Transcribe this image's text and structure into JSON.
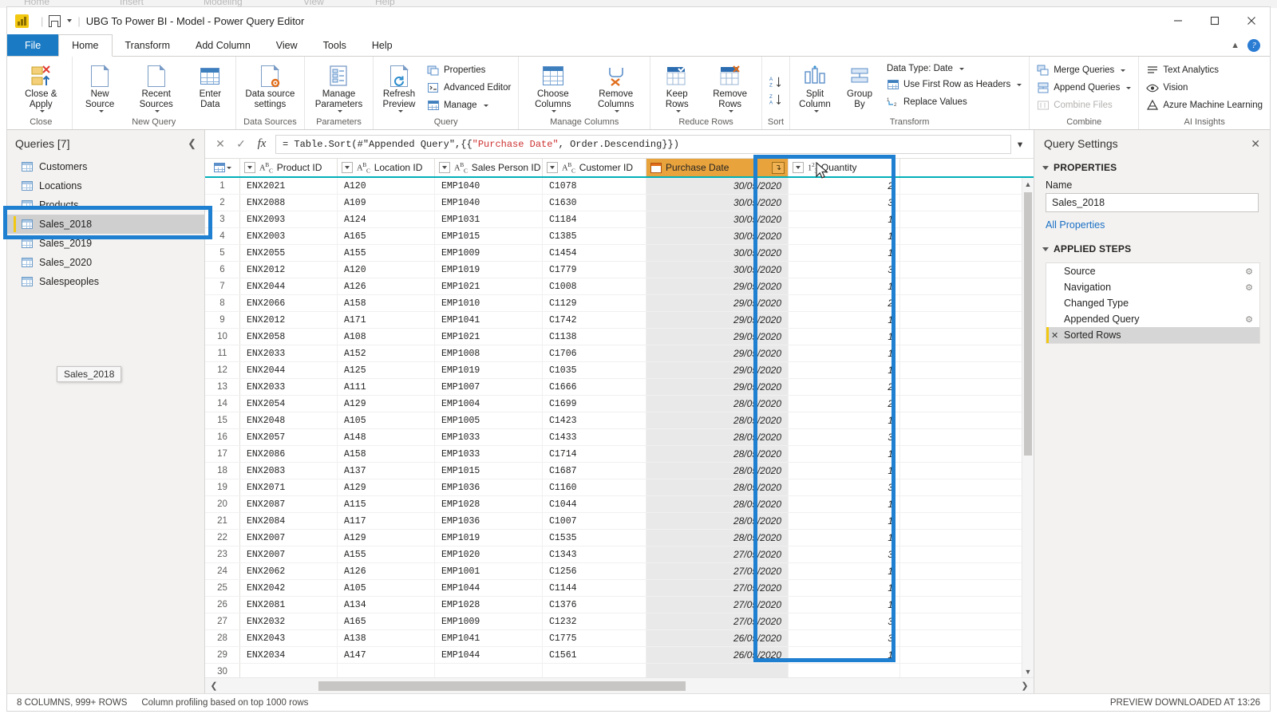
{
  "ghost_menu": [
    "Home",
    "Insert",
    "Modeling",
    "View",
    "Help"
  ],
  "titlebar": {
    "app_icon": "power-bi-logo",
    "save_icon": "save-icon",
    "dropdown_icon": "chevron-down-icon",
    "title": "UBG To Power BI - Model - Power Query Editor",
    "minimize": "minimize-icon",
    "maximize": "maximize-icon",
    "close": "close-icon",
    "collapse_ribbon": "chevron-up-icon",
    "help": "?"
  },
  "tabs": [
    {
      "label": "File",
      "state": "file"
    },
    {
      "label": "Home",
      "state": "active"
    },
    {
      "label": "Transform",
      "state": "normal"
    },
    {
      "label": "Add Column",
      "state": "normal"
    },
    {
      "label": "View",
      "state": "normal"
    },
    {
      "label": "Tools",
      "state": "normal"
    },
    {
      "label": "Help",
      "state": "normal"
    }
  ],
  "ribbon": {
    "groups": [
      {
        "name": "Close",
        "buttons": [
          {
            "label": "Close &\nApply",
            "icon": "close-apply-icon",
            "caret": true
          }
        ]
      },
      {
        "name": "New Query",
        "buttons": [
          {
            "label": "New\nSource",
            "icon": "new-source-icon",
            "caret": true
          },
          {
            "label": "Recent\nSources",
            "icon": "recent-sources-icon",
            "caret": true
          },
          {
            "label": "Enter\nData",
            "icon": "enter-data-icon",
            "caret": false
          }
        ]
      },
      {
        "name": "Data Sources",
        "buttons": [
          {
            "label": "Data source\nsettings",
            "icon": "data-source-settings-icon",
            "caret": false
          }
        ]
      },
      {
        "name": "Parameters",
        "buttons": [
          {
            "label": "Manage\nParameters",
            "icon": "manage-parameters-icon",
            "caret": true
          }
        ]
      },
      {
        "name": "Query",
        "buttons": [
          {
            "label": "Refresh\nPreview",
            "icon": "refresh-preview-icon",
            "caret": true
          }
        ],
        "small_buttons": [
          {
            "label": "Properties",
            "icon": "properties-icon",
            "disabled": false,
            "caret": false
          },
          {
            "label": "Advanced Editor",
            "icon": "advanced-editor-icon",
            "disabled": false,
            "caret": false
          },
          {
            "label": "Manage",
            "icon": "manage-icon",
            "disabled": false,
            "caret": true
          }
        ]
      },
      {
        "name": "Manage Columns",
        "buttons": [
          {
            "label": "Choose\nColumns",
            "icon": "choose-columns-icon",
            "caret": true
          },
          {
            "label": "Remove\nColumns",
            "icon": "remove-columns-icon",
            "caret": true
          }
        ]
      },
      {
        "name": "Reduce Rows",
        "buttons": [
          {
            "label": "Keep\nRows",
            "icon": "keep-rows-icon",
            "caret": true
          },
          {
            "label": "Remove\nRows",
            "icon": "remove-rows-icon",
            "caret": true
          }
        ]
      },
      {
        "name": "Sort",
        "small_buttons": [
          {
            "label": "",
            "icon": "sort-ascending-icon",
            "disabled": false,
            "caret": false
          },
          {
            "label": "",
            "icon": "sort-descending-icon",
            "disabled": false,
            "caret": false
          }
        ]
      },
      {
        "name": "Transform",
        "buttons": [
          {
            "label": "Split\nColumn",
            "icon": "split-column-icon",
            "caret": true
          },
          {
            "label": "Group\nBy",
            "icon": "group-by-icon",
            "caret": false
          }
        ],
        "small_buttons": [
          {
            "label": "Data Type: Date",
            "icon": "data-type-icon",
            "disabled": false,
            "caret": true
          },
          {
            "label": "Use First Row as Headers",
            "icon": "first-row-headers-icon",
            "disabled": false,
            "caret": true
          },
          {
            "label": "Replace Values",
            "icon": "replace-values-icon",
            "disabled": false,
            "caret": false
          }
        ]
      },
      {
        "name": "Combine",
        "small_buttons": [
          {
            "label": "Merge Queries",
            "icon": "merge-queries-icon",
            "disabled": false,
            "caret": true
          },
          {
            "label": "Append Queries",
            "icon": "append-queries-icon",
            "disabled": false,
            "caret": true
          },
          {
            "label": "Combine Files",
            "icon": "combine-files-icon",
            "disabled": true,
            "caret": false
          }
        ]
      },
      {
        "name": "AI Insights",
        "small_buttons": [
          {
            "label": "Text Analytics",
            "icon": "text-analytics-icon",
            "disabled": false,
            "caret": false
          },
          {
            "label": "Vision",
            "icon": "vision-eye-icon",
            "disabled": false,
            "caret": false
          },
          {
            "label": "Azure Machine Learning",
            "icon": "azure-ml-icon",
            "disabled": false,
            "caret": false
          }
        ]
      }
    ]
  },
  "queries_pane": {
    "header": "Queries [7]",
    "collapse_icon": "chevron-left-icon",
    "items": [
      {
        "label": "Customers",
        "selected": false
      },
      {
        "label": "Locations",
        "selected": false
      },
      {
        "label": "Products",
        "selected": false
      },
      {
        "label": "Sales_2018",
        "selected": true
      },
      {
        "label": "Sales_2019",
        "selected": false
      },
      {
        "label": "Sales_2020",
        "selected": false
      },
      {
        "label": "Salespeoples",
        "selected": false
      }
    ],
    "tooltip": "Sales_2018"
  },
  "formula_bar": {
    "cancel_icon": "cancel-x-icon",
    "commit_icon": "commit-check-icon",
    "fx_icon": "fx-icon",
    "formula_prefix": "= Table.Sort(#\"Appended Query\",{{",
    "formula_string": "\"Purchase Date\"",
    "formula_suffix": ", Order.Descending}})",
    "expand_icon": "chevron-down-icon"
  },
  "grid": {
    "corner_icon": "select-all-table-icon",
    "columns": [
      {
        "name": "Product ID",
        "type_icon": "ABC",
        "type": "text",
        "sorted": false
      },
      {
        "name": "Location ID",
        "type_icon": "ABC",
        "type": "text",
        "sorted": false
      },
      {
        "name": "Sales Person ID",
        "type_icon": "ABC",
        "type": "text",
        "sorted": false
      },
      {
        "name": "Customer ID",
        "type_icon": "ABC",
        "type": "text",
        "sorted": false
      },
      {
        "name": "Purchase Date",
        "type_icon": "calendar",
        "type": "date",
        "sorted": true,
        "sort_direction": "descending"
      },
      {
        "name": "Quantity",
        "type_icon": "123",
        "type": "number",
        "sorted": false
      }
    ],
    "rows": [
      {
        "n": "1",
        "product": "ENX2021",
        "location": "A120",
        "salesperson": "EMP1040",
        "customer": "C1078",
        "date": "30/05/2020",
        "qty": "2"
      },
      {
        "n": "2",
        "product": "ENX2088",
        "location": "A109",
        "salesperson": "EMP1040",
        "customer": "C1630",
        "date": "30/05/2020",
        "qty": "3"
      },
      {
        "n": "3",
        "product": "ENX2093",
        "location": "A124",
        "salesperson": "EMP1031",
        "customer": "C1184",
        "date": "30/05/2020",
        "qty": "1"
      },
      {
        "n": "4",
        "product": "ENX2003",
        "location": "A165",
        "salesperson": "EMP1015",
        "customer": "C1385",
        "date": "30/05/2020",
        "qty": "1"
      },
      {
        "n": "5",
        "product": "ENX2055",
        "location": "A155",
        "salesperson": "EMP1009",
        "customer": "C1454",
        "date": "30/05/2020",
        "qty": "1"
      },
      {
        "n": "6",
        "product": "ENX2012",
        "location": "A120",
        "salesperson": "EMP1019",
        "customer": "C1779",
        "date": "30/05/2020",
        "qty": "3"
      },
      {
        "n": "7",
        "product": "ENX2044",
        "location": "A126",
        "salesperson": "EMP1021",
        "customer": "C1008",
        "date": "29/05/2020",
        "qty": "1"
      },
      {
        "n": "8",
        "product": "ENX2066",
        "location": "A158",
        "salesperson": "EMP1010",
        "customer": "C1129",
        "date": "29/05/2020",
        "qty": "2"
      },
      {
        "n": "9",
        "product": "ENX2012",
        "location": "A171",
        "salesperson": "EMP1041",
        "customer": "C1742",
        "date": "29/05/2020",
        "qty": "1"
      },
      {
        "n": "10",
        "product": "ENX2058",
        "location": "A108",
        "salesperson": "EMP1021",
        "customer": "C1138",
        "date": "29/05/2020",
        "qty": "1"
      },
      {
        "n": "11",
        "product": "ENX2033",
        "location": "A152",
        "salesperson": "EMP1008",
        "customer": "C1706",
        "date": "29/05/2020",
        "qty": "1"
      },
      {
        "n": "12",
        "product": "ENX2044",
        "location": "A125",
        "salesperson": "EMP1019",
        "customer": "C1035",
        "date": "29/05/2020",
        "qty": "1"
      },
      {
        "n": "13",
        "product": "ENX2033",
        "location": "A111",
        "salesperson": "EMP1007",
        "customer": "C1666",
        "date": "29/05/2020",
        "qty": "2"
      },
      {
        "n": "14",
        "product": "ENX2054",
        "location": "A129",
        "salesperson": "EMP1004",
        "customer": "C1699",
        "date": "28/05/2020",
        "qty": "2"
      },
      {
        "n": "15",
        "product": "ENX2048",
        "location": "A105",
        "salesperson": "EMP1005",
        "customer": "C1423",
        "date": "28/05/2020",
        "qty": "1"
      },
      {
        "n": "16",
        "product": "ENX2057",
        "location": "A148",
        "salesperson": "EMP1033",
        "customer": "C1433",
        "date": "28/05/2020",
        "qty": "3"
      },
      {
        "n": "17",
        "product": "ENX2086",
        "location": "A158",
        "salesperson": "EMP1033",
        "customer": "C1714",
        "date": "28/05/2020",
        "qty": "1"
      },
      {
        "n": "18",
        "product": "ENX2083",
        "location": "A137",
        "salesperson": "EMP1015",
        "customer": "C1687",
        "date": "28/05/2020",
        "qty": "1"
      },
      {
        "n": "19",
        "product": "ENX2071",
        "location": "A129",
        "salesperson": "EMP1036",
        "customer": "C1160",
        "date": "28/05/2020",
        "qty": "3"
      },
      {
        "n": "20",
        "product": "ENX2087",
        "location": "A115",
        "salesperson": "EMP1028",
        "customer": "C1044",
        "date": "28/05/2020",
        "qty": "1"
      },
      {
        "n": "21",
        "product": "ENX2084",
        "location": "A117",
        "salesperson": "EMP1036",
        "customer": "C1007",
        "date": "28/05/2020",
        "qty": "1"
      },
      {
        "n": "22",
        "product": "ENX2007",
        "location": "A129",
        "salesperson": "EMP1019",
        "customer": "C1535",
        "date": "28/05/2020",
        "qty": "1"
      },
      {
        "n": "23",
        "product": "ENX2007",
        "location": "A155",
        "salesperson": "EMP1020",
        "customer": "C1343",
        "date": "27/05/2020",
        "qty": "3"
      },
      {
        "n": "24",
        "product": "ENX2062",
        "location": "A126",
        "salesperson": "EMP1001",
        "customer": "C1256",
        "date": "27/05/2020",
        "qty": "1"
      },
      {
        "n": "25",
        "product": "ENX2042",
        "location": "A105",
        "salesperson": "EMP1044",
        "customer": "C1144",
        "date": "27/05/2020",
        "qty": "1"
      },
      {
        "n": "26",
        "product": "ENX2081",
        "location": "A134",
        "salesperson": "EMP1028",
        "customer": "C1376",
        "date": "27/05/2020",
        "qty": "1"
      },
      {
        "n": "27",
        "product": "ENX2032",
        "location": "A165",
        "salesperson": "EMP1009",
        "customer": "C1232",
        "date": "27/05/2020",
        "qty": "3"
      },
      {
        "n": "28",
        "product": "ENX2043",
        "location": "A138",
        "salesperson": "EMP1041",
        "customer": "C1775",
        "date": "26/05/2020",
        "qty": "3"
      },
      {
        "n": "29",
        "product": "ENX2034",
        "location": "A147",
        "salesperson": "EMP1044",
        "customer": "C1561",
        "date": "26/05/2020",
        "qty": "1"
      },
      {
        "n": "30",
        "product": "",
        "location": "",
        "salesperson": "",
        "customer": "",
        "date": "",
        "qty": ""
      }
    ]
  },
  "query_settings": {
    "title": "Query Settings",
    "close_icon": "close-icon",
    "properties_section": "PROPERTIES",
    "name_label": "Name",
    "name_value": "Sales_2018",
    "all_properties_link": "All Properties",
    "applied_steps_section": "APPLIED STEPS",
    "steps": [
      {
        "label": "Source",
        "gear": true,
        "selected": false
      },
      {
        "label": "Navigation",
        "gear": true,
        "selected": false
      },
      {
        "label": "Changed Type",
        "gear": false,
        "selected": false
      },
      {
        "label": "Appended Query",
        "gear": true,
        "selected": false
      },
      {
        "label": "Sorted Rows",
        "gear": false,
        "selected": true
      }
    ]
  },
  "statusbar": {
    "columns_rows": "8 COLUMNS, 999+ ROWS",
    "profiling": "Column profiling based on top 1000 rows",
    "preview": "PREVIEW DOWNLOADED AT 13:26"
  },
  "colors": {
    "accent_blue": "#1a7bc4",
    "annotation_blue": "#1f7fd0",
    "sorted_header_gold": "#e8a33d",
    "header_underline_teal": "#00b0b9",
    "selection_yellow": "#f2c811"
  }
}
